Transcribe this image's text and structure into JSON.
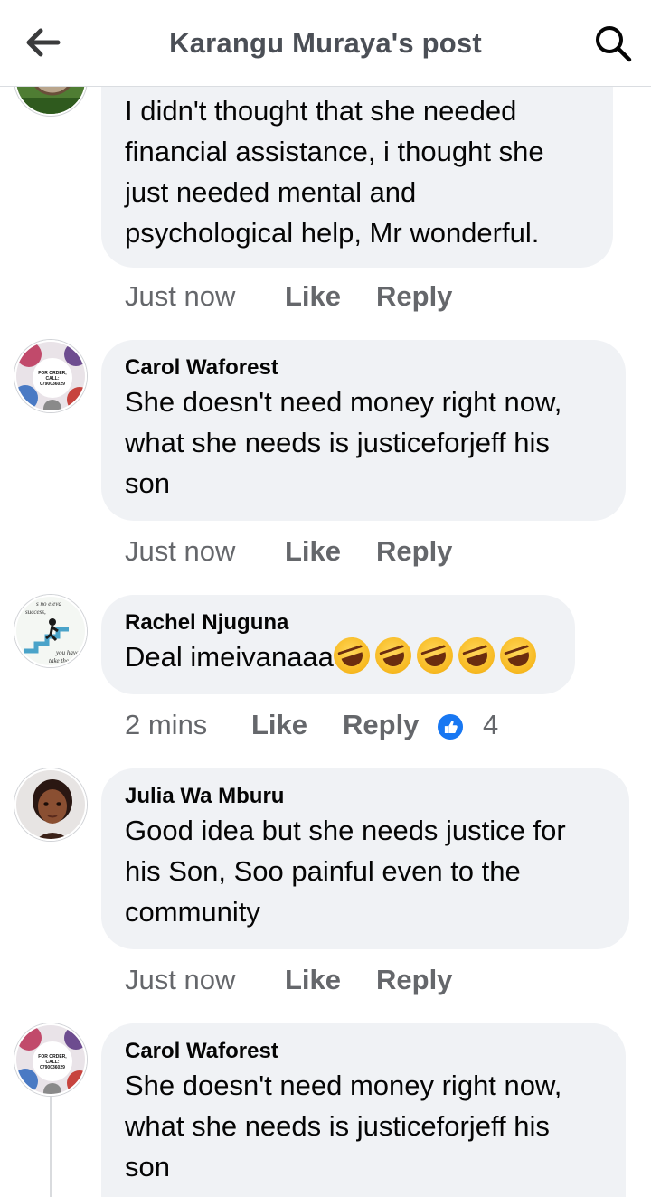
{
  "header": {
    "title": "Karangu Muraya's post"
  },
  "comments": [
    {
      "body": "I didn't thought that she needed financial assistance, i thought she just needed mental and psychological help, Mr wonderful.",
      "time": "Just now",
      "like": "Like",
      "reply": "Reply"
    },
    {
      "author": "Carol Waforest",
      "body": "She doesn't need money right now, what she needs is justiceforjeff his son",
      "time": "Just now",
      "like": "Like",
      "reply": "Reply",
      "avatar_text": "FOR ORDER, CALL: 0790036029"
    },
    {
      "author": "Rachel Njuguna",
      "body": "Deal imeivanaaa",
      "emoji_count": 5,
      "time": "2 mins",
      "like": "Like",
      "reply": "Reply",
      "reaction_count": "4",
      "avatar_text_top": "s no eleva success,",
      "avatar_text_bottom": "you have to take the s"
    },
    {
      "author": "Julia Wa Mburu",
      "body": "Good idea but she needs justice for his Son, Soo painful even to the community",
      "time": "Just now",
      "like": "Like",
      "reply": "Reply"
    },
    {
      "author": "Carol Waforest",
      "body": "She doesn't need money right now, what she needs is justiceforjeff his son",
      "avatar_text": "FOR ORDER, CALL: 0790036029"
    }
  ],
  "icons": {
    "back": "arrow-left-icon",
    "search": "search-icon",
    "reaction": "like-reaction-icon",
    "emoji": "rolling-on-floor-laughing-icon"
  },
  "colors": {
    "bubble": "#f0f2f5",
    "meta_text": "#65676b",
    "accent": "#1877f2"
  }
}
